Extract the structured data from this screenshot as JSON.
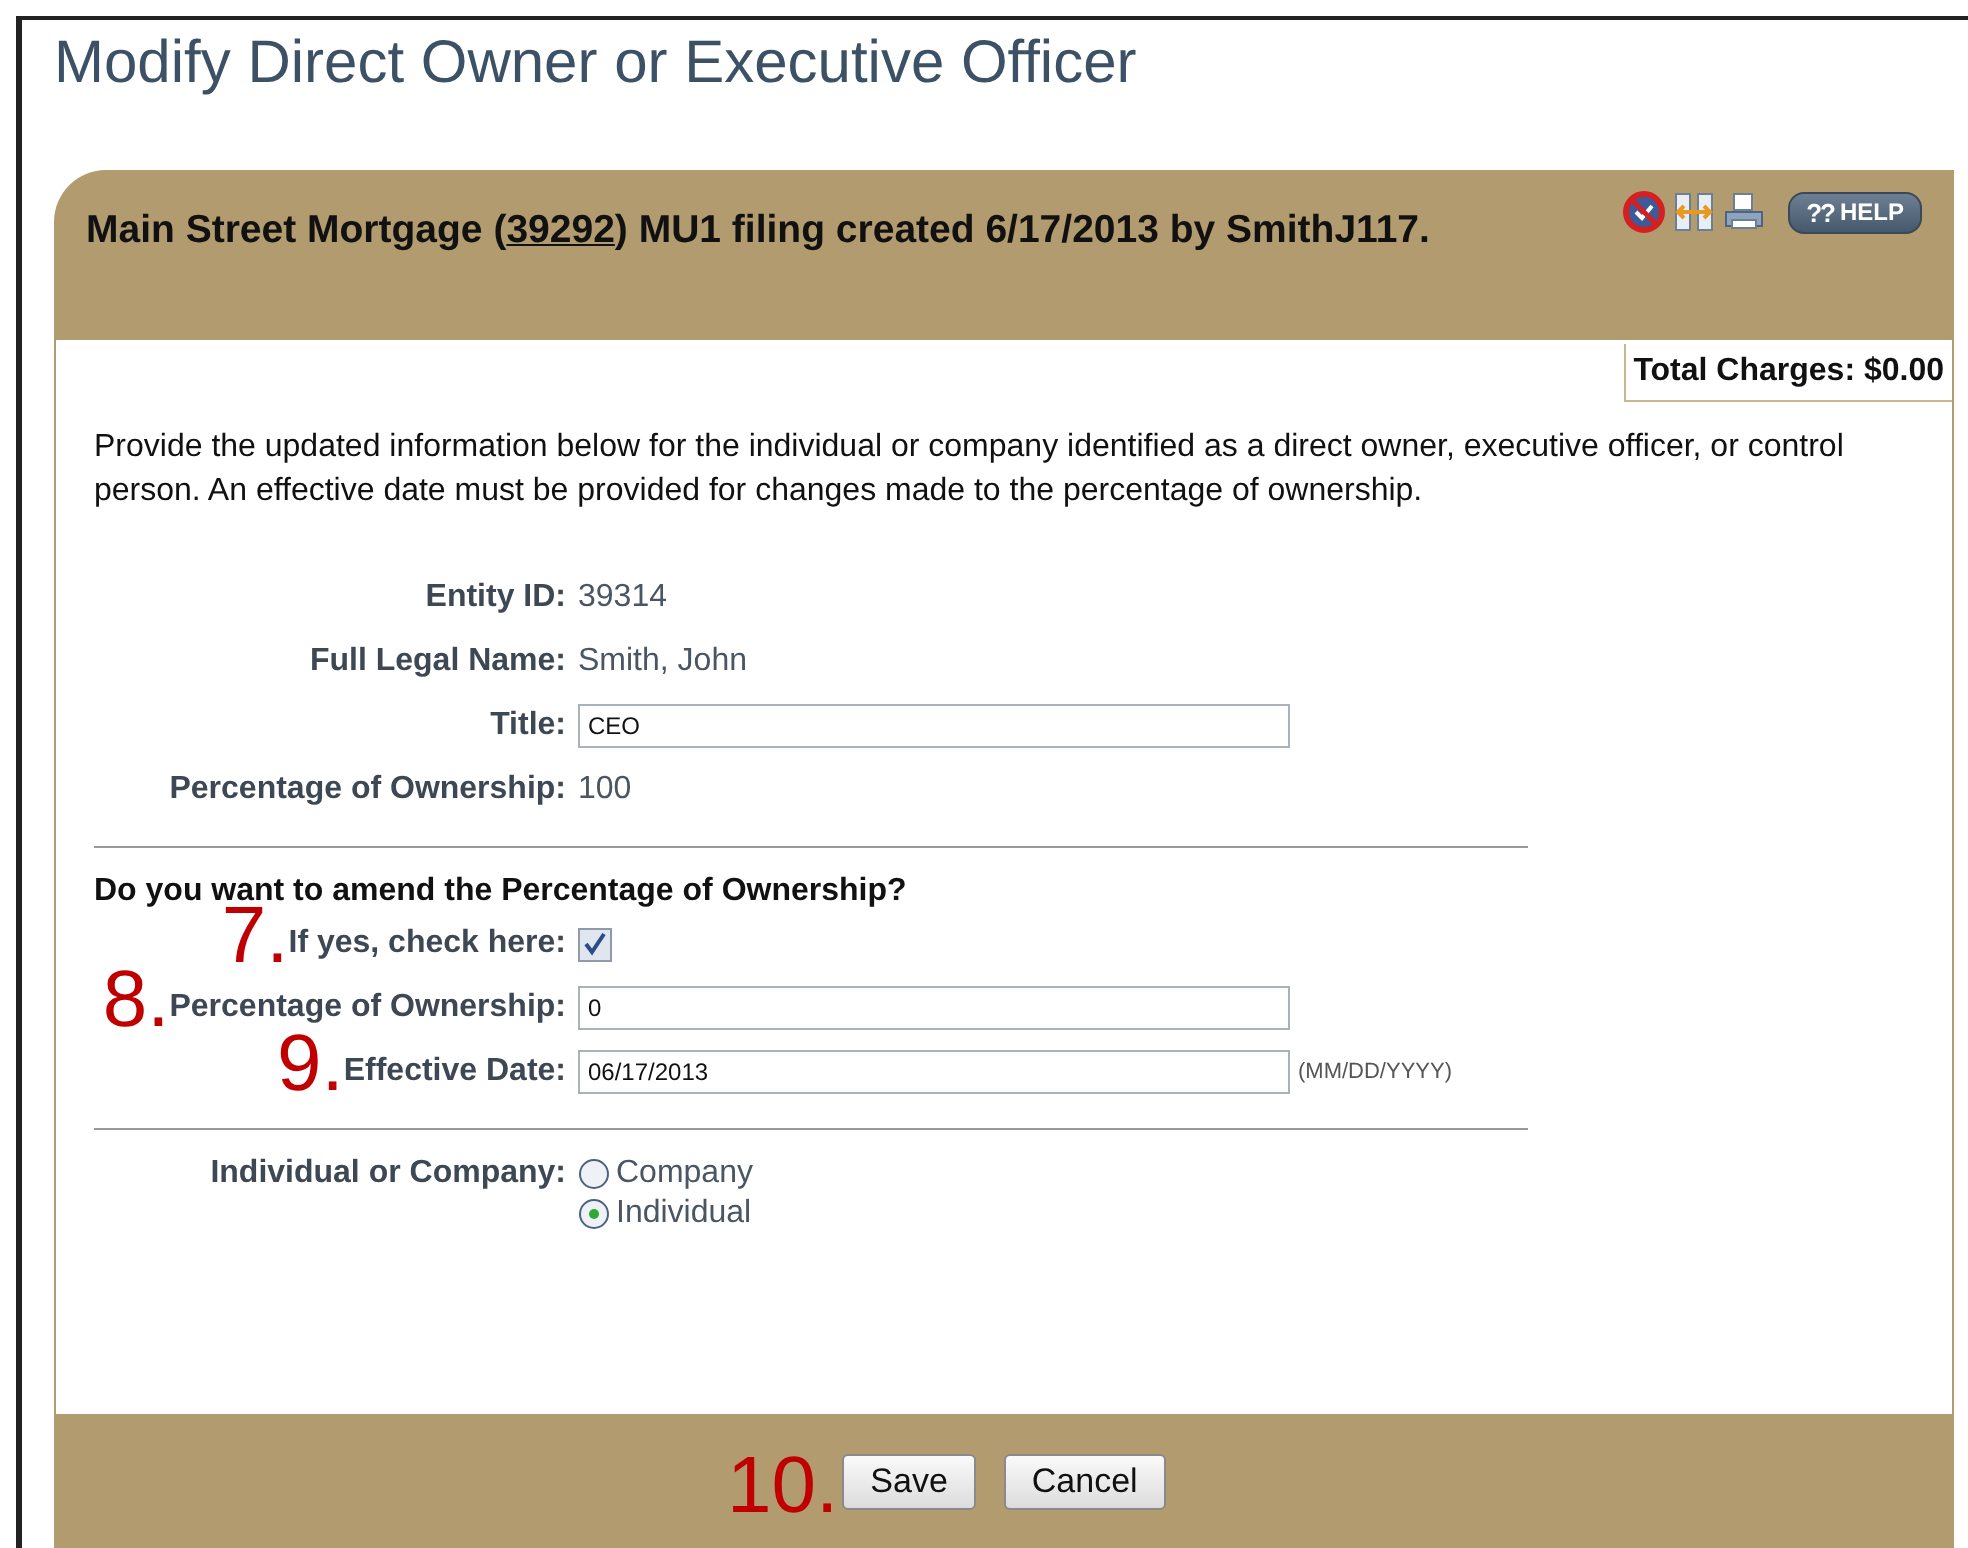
{
  "page_title": "Modify Direct Owner or Executive Officer",
  "header": {
    "before": "Main Street Mortgage (",
    "link": "39292",
    "after": ") MU1 filing created 6/17/2013 by SmithJ117.",
    "help": {
      "glyph": "??",
      "label": "HELP"
    }
  },
  "total_charges": "Total Charges: $0.00",
  "intro": "Provide the updated information below for the individual or company identified as a direct owner, executive officer, or control person. An effective date must be provided for changes made to the percentage of ownership.",
  "sections": [
    {
      "rows": [
        {
          "kind": "static",
          "label": "Entity ID:",
          "value": "39314"
        },
        {
          "kind": "static",
          "label": "Full Legal Name:",
          "value": "Smith, John"
        },
        {
          "kind": "text",
          "label": "Title:",
          "value": "CEO"
        },
        {
          "kind": "static",
          "label": "Percentage of Ownership:",
          "value": "100"
        }
      ]
    },
    {
      "heading": "Do you want to amend the Percentage of Ownership?",
      "rows": [
        {
          "kind": "checkbox",
          "callout": "7.",
          "label": "If yes, check here:",
          "checked": true
        },
        {
          "kind": "text",
          "callout": "8.",
          "label": "Percentage of Ownership:",
          "value": "0"
        },
        {
          "kind": "text",
          "callout": "9.",
          "label": "Effective Date:",
          "value": "06/17/2013",
          "hint": "(MM/DD/YYYY)"
        }
      ]
    },
    {
      "rows": [
        {
          "kind": "radio",
          "label": "Individual or Company:",
          "options": [
            {
              "label": "Company",
              "selected": false
            },
            {
              "label": "Individual",
              "selected": true
            }
          ]
        }
      ]
    }
  ],
  "footer": {
    "callout": "10.",
    "buttons": [
      "Save",
      "Cancel"
    ]
  }
}
